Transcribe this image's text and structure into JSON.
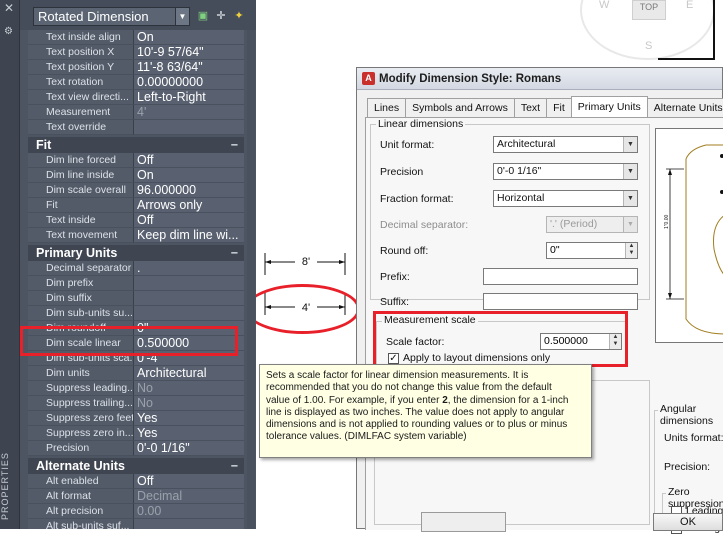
{
  "palette": {
    "side_label": "PROPERTIES",
    "object_type": "Rotated Dimension",
    "sections": [
      {
        "title": "",
        "rows": [
          {
            "key": "Text inside align",
            "value": "On"
          },
          {
            "key": "Text position X",
            "value": "10'-9 57/64\""
          },
          {
            "key": "Text position Y",
            "value": "11'-8 63/64\""
          },
          {
            "key": "Text rotation",
            "value": "0.00000000"
          },
          {
            "key": "Text view directi...",
            "value": "Left-to-Right"
          },
          {
            "key": "Measurement",
            "value": "4'",
            "dim": true
          },
          {
            "key": "Text override",
            "value": ""
          }
        ]
      },
      {
        "title": "Fit",
        "rows": [
          {
            "key": "Dim line forced",
            "value": "Off"
          },
          {
            "key": "Dim line inside",
            "value": "On"
          },
          {
            "key": "Dim scale overall",
            "value": "96.000000"
          },
          {
            "key": "Fit",
            "value": "Arrows only"
          },
          {
            "key": "Text inside",
            "value": "Off"
          },
          {
            "key": "Text movement",
            "value": "Keep dim line wi..."
          }
        ]
      },
      {
        "title": "Primary Units",
        "rows": [
          {
            "key": "Decimal separator",
            "value": "."
          },
          {
            "key": "Dim prefix",
            "value": ""
          },
          {
            "key": "Dim suffix",
            "value": ""
          },
          {
            "key": "Dim sub-units su...",
            "value": ""
          },
          {
            "key": "Dim roundoff",
            "value": "0\""
          },
          {
            "key": "Dim scale linear",
            "value": "0.500000"
          },
          {
            "key": "Dim sub-units sca...",
            "value": "0'-4\""
          },
          {
            "key": "Dim units",
            "value": "Architectural"
          },
          {
            "key": "Suppress leading...",
            "value": "No",
            "dim": true
          },
          {
            "key": "Suppress trailing...",
            "value": "No",
            "dim": true
          },
          {
            "key": "Suppress zero feet",
            "value": "Yes"
          },
          {
            "key": "Suppress zero in...",
            "value": "Yes"
          },
          {
            "key": "Precision",
            "value": "0'-0 1/16\""
          }
        ]
      },
      {
        "title": "Alternate Units",
        "rows": [
          {
            "key": "Alt enabled",
            "value": "Off"
          },
          {
            "key": "Alt format",
            "value": "Decimal",
            "dim": true
          },
          {
            "key": "Alt precision",
            "value": "0.00",
            "dim": true
          },
          {
            "key": "Alt sub-units suf...",
            "value": ""
          }
        ]
      }
    ]
  },
  "viewcube": {
    "top": "TOP",
    "w": "W",
    "e": "E",
    "s": "S"
  },
  "sketch": {
    "dim1": "8'",
    "dim2": "4'"
  },
  "dialog": {
    "title": "Modify Dimension Style: Romans",
    "tabs": [
      "Lines",
      "Symbols and Arrows",
      "Text",
      "Fit",
      "Primary Units",
      "Alternate Units",
      "T"
    ],
    "active_tab": "Primary Units",
    "linear_group": "Linear dimensions",
    "unit_format_label": "Unit format:",
    "unit_format_value": "Architectural",
    "precision_label": "Precision",
    "precision_value": "0'-0 1/16\"",
    "fraction_format_label": "Fraction format:",
    "fraction_format_value": "Horizontal",
    "decimal_sep_label": "Decimal separator:",
    "decimal_sep_value": "'.' (Period)",
    "round_off_label": "Round off:",
    "round_off_value": "0\"",
    "prefix_label": "Prefix:",
    "suffix_label": "Suffix:",
    "measurement_group": "Measurement scale",
    "scale_factor_label": "Scale factor:",
    "scale_factor_value": "0.500000",
    "apply_layout_label": "Apply to layout dimensions only",
    "angular_group": "Angular dimensions",
    "angular_units_label": "Units format:",
    "angular_precision_label": "Precision:",
    "zero_suppress_group": "Zero suppression",
    "leading_label": "Leading",
    "trailing_label": "Trailing",
    "ok_label": "OK",
    "preview_dim": "1\"0.00"
  },
  "tooltip": {
    "line1": "Sets a scale factor for linear dimension measurements. It is",
    "line2": "recommended that you do not change this value from the default",
    "line3": "value of 1.00. For example, if you enter ",
    "bold": "2",
    "line3b": ", the dimension for a 1-inch",
    "line4": "line is displayed as two inches. The value does not apply to angular",
    "line5": "dimensions and is not applied to rounding values or to plus or minus",
    "line6": "tolerance values. (DIMLFAC system variable)"
  }
}
